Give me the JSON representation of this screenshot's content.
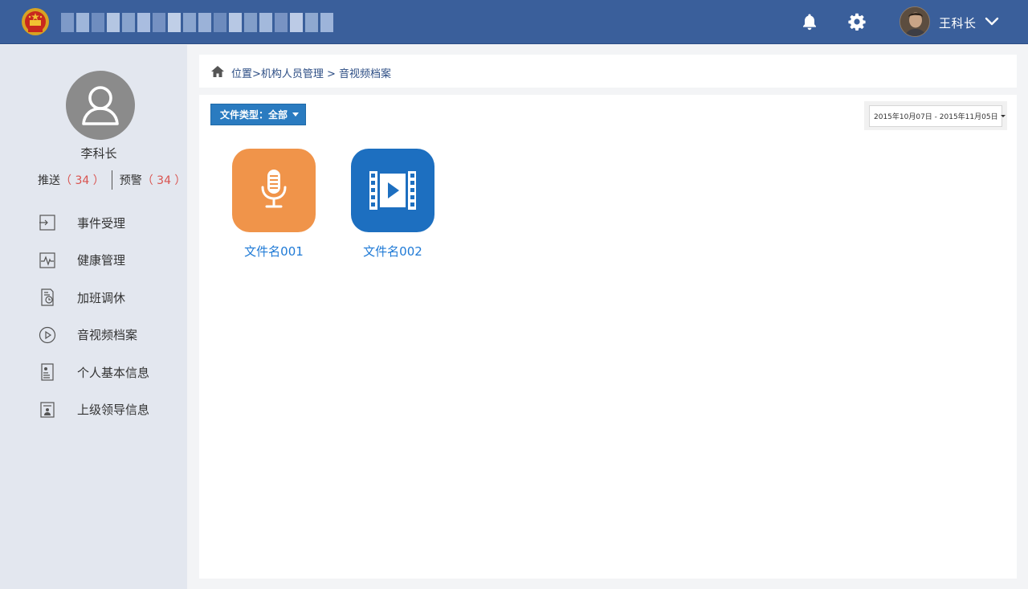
{
  "header": {
    "user_name": "王科长",
    "icons": [
      "national-emblem-icon",
      "bell-icon",
      "gear-icon",
      "chevron-down-icon"
    ],
    "colors": {
      "bar": "#3a5f9b"
    }
  },
  "sidebar": {
    "profile_name": "李科长",
    "push_label": "推送",
    "push_count": "（ 34 ）",
    "warn_label": "预警",
    "warn_count": "（ 34 ）",
    "items": [
      {
        "label": "事件受理",
        "icon": "login-arrow-icon"
      },
      {
        "label": "健康管理",
        "icon": "heartbeat-icon"
      },
      {
        "label": "加班调休",
        "icon": "document-clock-icon"
      },
      {
        "label": "音视频档案",
        "icon": "play-circle-icon"
      },
      {
        "label": "个人基本信息",
        "icon": "id-card-icon"
      },
      {
        "label": "上级领导信息",
        "icon": "person-card-icon"
      }
    ]
  },
  "breadcrumb": {
    "text": "位置>机构人员管理 > 音视频档案"
  },
  "toolbar": {
    "filter_label": "文件类型：全部",
    "date_range": "2015年10月07日 - 2015年11月05日"
  },
  "files": [
    {
      "name": "文件名001",
      "type": "audio",
      "icon": "microphone-icon",
      "color": "#f0944a"
    },
    {
      "name": "文件名002",
      "type": "video",
      "icon": "film-play-icon",
      "color": "#1d6fc0"
    }
  ]
}
